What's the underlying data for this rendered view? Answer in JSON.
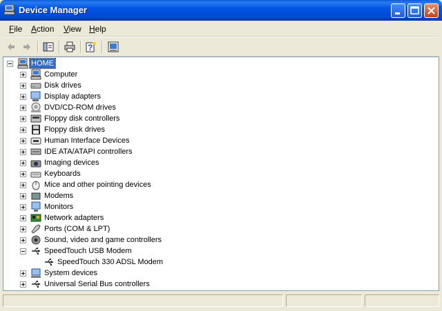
{
  "window": {
    "title": "Device Manager"
  },
  "menu": [
    {
      "label": "File",
      "accel": "F",
      "rest": "ile"
    },
    {
      "label": "Action",
      "accel": "A",
      "rest": "ction"
    },
    {
      "label": "View",
      "accel": "V",
      "rest": "iew"
    },
    {
      "label": "Help",
      "accel": "H",
      "rest": "elp"
    }
  ],
  "toolbar": {
    "buttons": [
      {
        "name": "back-button",
        "icon": "back-arrow-icon",
        "enabled": false
      },
      {
        "name": "forward-button",
        "icon": "forward-arrow-icon",
        "enabled": false
      },
      {
        "name": "show-hide-console-tree-button",
        "icon": "console-tree-icon",
        "enabled": true
      },
      {
        "name": "print-button",
        "icon": "printer-icon",
        "enabled": true
      },
      {
        "name": "help-button",
        "icon": "help-icon",
        "enabled": true
      },
      {
        "name": "properties-button",
        "icon": "properties-icon",
        "enabled": true
      }
    ]
  },
  "tree": {
    "root": {
      "label": "HOME",
      "icon": "computer-icon",
      "expanded": true,
      "selected": true
    },
    "categories": [
      {
        "label": "Computer",
        "icon": "computer-icon",
        "expanded": false
      },
      {
        "label": "Disk drives",
        "icon": "disk-drive-icon",
        "expanded": false
      },
      {
        "label": "Display adapters",
        "icon": "display-adapter-icon",
        "expanded": false
      },
      {
        "label": "DVD/CD-ROM drives",
        "icon": "cd-drive-icon",
        "expanded": false
      },
      {
        "label": "Floppy disk controllers",
        "icon": "floppy-controller-icon",
        "expanded": false
      },
      {
        "label": "Floppy disk drives",
        "icon": "floppy-drive-icon",
        "expanded": false
      },
      {
        "label": "Human Interface Devices",
        "icon": "hid-icon",
        "expanded": false
      },
      {
        "label": "IDE ATA/ATAPI controllers",
        "icon": "ide-controller-icon",
        "expanded": false
      },
      {
        "label": "Imaging devices",
        "icon": "imaging-device-icon",
        "expanded": false
      },
      {
        "label": "Keyboards",
        "icon": "keyboard-icon",
        "expanded": false
      },
      {
        "label": "Mice and other pointing devices",
        "icon": "mouse-icon",
        "expanded": false
      },
      {
        "label": "Modems",
        "icon": "modem-icon",
        "expanded": false
      },
      {
        "label": "Monitors",
        "icon": "monitor-icon",
        "expanded": false
      },
      {
        "label": "Network adapters",
        "icon": "network-adapter-icon",
        "expanded": false
      },
      {
        "label": "Ports (COM & LPT)",
        "icon": "port-icon",
        "expanded": false
      },
      {
        "label": "Sound, video and game controllers",
        "icon": "sound-icon",
        "expanded": false
      },
      {
        "label": "SpeedTouch USB Modem",
        "icon": "usb-icon",
        "expanded": true,
        "children": [
          {
            "label": "SpeedTouch 330 ADSL Modem",
            "icon": "usb-icon"
          }
        ]
      },
      {
        "label": "System devices",
        "icon": "system-device-icon",
        "expanded": false
      },
      {
        "label": "Universal Serial Bus controllers",
        "icon": "usb-icon",
        "expanded": false
      }
    ]
  },
  "colors": {
    "titlebar": "#0054e3",
    "selection": "#316ac5",
    "window_bg": "#ece9d8"
  }
}
